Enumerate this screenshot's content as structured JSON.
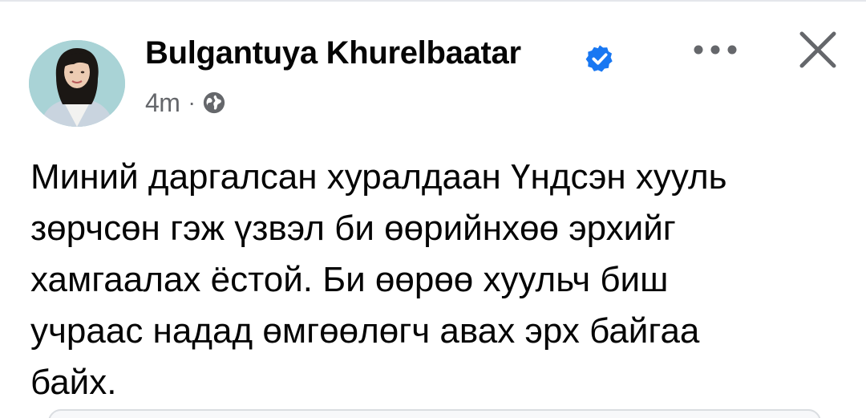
{
  "post": {
    "author_name": "Bulgantuya Khurelbaatar",
    "verified_icon": "verified-badge-icon",
    "time": "4m",
    "separator": "·",
    "audience_icon": "globe-icon",
    "more_icon": "more-options-icon",
    "close_icon": "close-icon",
    "text_lines": [
      "Миний даргалсан хуралдаан Үндсэн хууль",
      "зөрчсөн гэж үзвэл би өөрийнхөө эрхийг",
      "хамгаалах ёстой. Би өөрөө хуульч биш",
      "учраас надад өмгөөлөгч авах эрх байгаа",
      "байх."
    ]
  },
  "colors": {
    "text": "#050505",
    "secondary_text": "#65676b",
    "verified_blue": "#1877f2",
    "icon_dark": "#65676b"
  }
}
